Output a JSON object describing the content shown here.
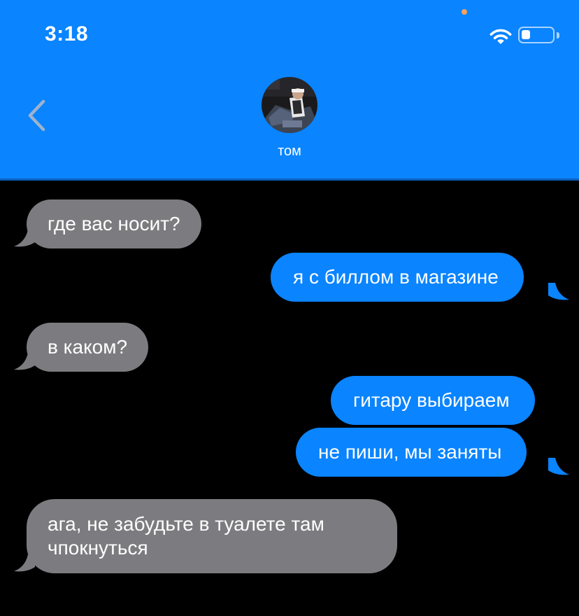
{
  "status_bar": {
    "time": "3:18",
    "battery_level": 0.3
  },
  "header": {
    "contact_name": "том",
    "back_icon": "chevron-left-icon",
    "avatar": "contact-photo"
  },
  "colors": {
    "header_bg": "#0a84ff",
    "incoming_bubble": "#7c7c80",
    "outgoing_bubble": "#0a84ff",
    "background": "#000000"
  },
  "messages": [
    {
      "direction": "incoming",
      "text": "где вас носит?"
    },
    {
      "direction": "outgoing",
      "text": "я с биллом в магазине"
    },
    {
      "direction": "incoming",
      "text": "в каком?"
    },
    {
      "direction": "outgoing",
      "text": "гитару выбираем"
    },
    {
      "direction": "outgoing",
      "text": "не пиши, мы заняты"
    },
    {
      "direction": "incoming",
      "text": "ага, не забудьте в туалете там чпокнуться"
    }
  ]
}
